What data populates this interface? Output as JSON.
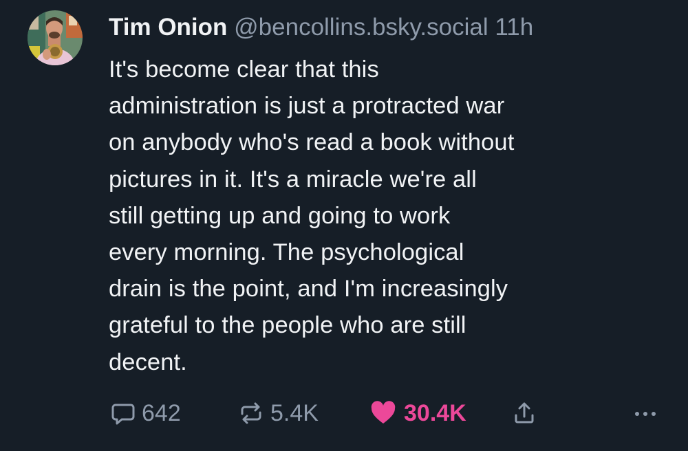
{
  "author": {
    "name": "Tim Onion",
    "handle": "@bencollins.bsky.social",
    "timestamp": "11h"
  },
  "post": {
    "text": "It's become clear that this\nadministration is just a protracted war\non anybody who's read a book without\npictures in it. It's a miracle we're all\nstill getting up and going to work\nevery morning. The psychological\ndrain is the point, and I'm increasingly\ngrateful to the people who are still\ndecent."
  },
  "actions": {
    "replies": "642",
    "reposts": "5.4K",
    "likes": "30.4K"
  },
  "icons": {
    "reply": "reply-icon",
    "repost": "repost-icon",
    "like": "heart-icon",
    "share": "share-icon",
    "more": "more-icon"
  },
  "colors": {
    "background": "#161e27",
    "text": "#f1f3f5",
    "muted": "#8f9bab",
    "like_accent": "#ec4899"
  }
}
